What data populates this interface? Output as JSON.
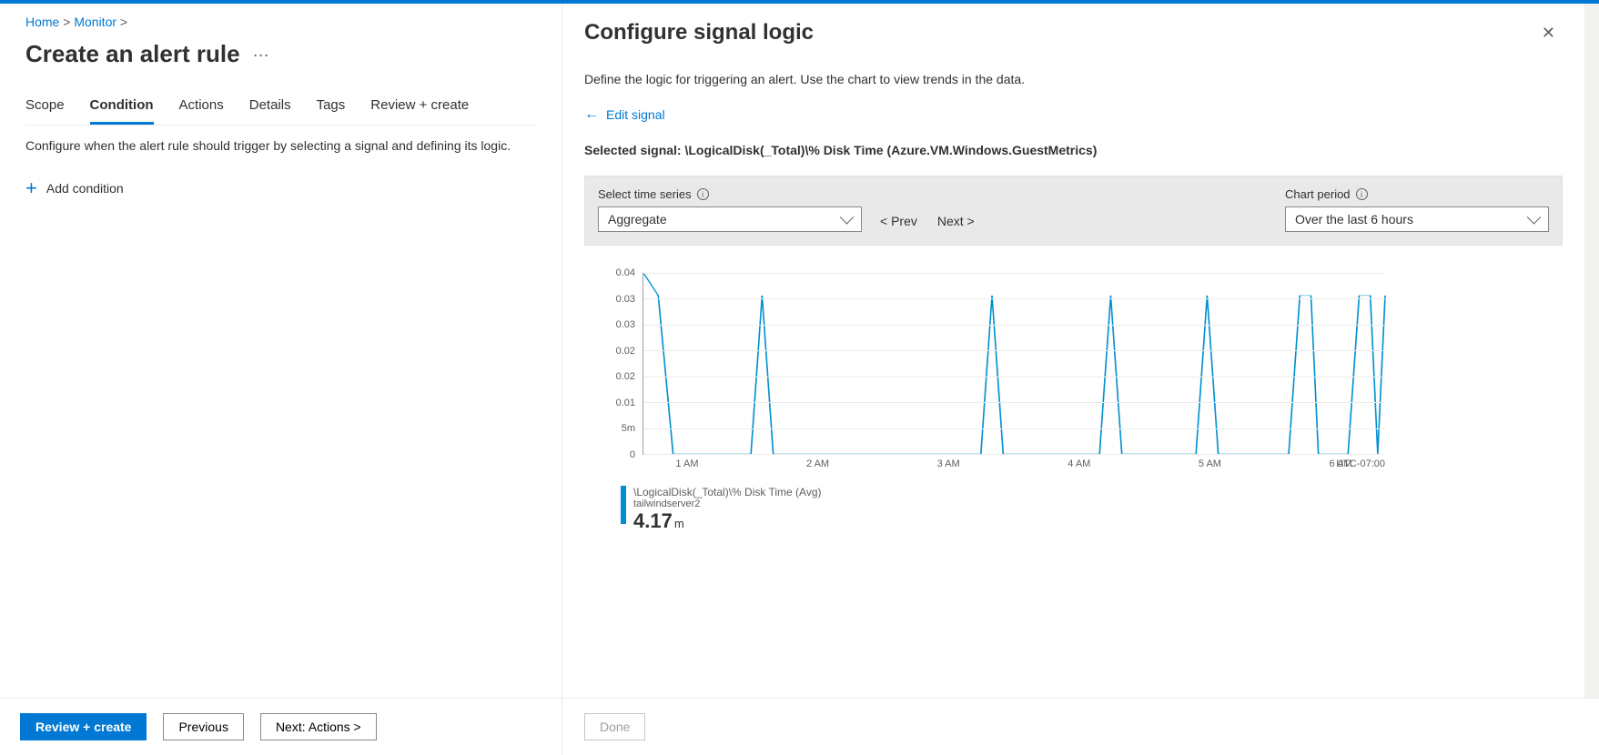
{
  "breadcrumbs": {
    "home": "Home",
    "monitor": "Monitor"
  },
  "page_title": "Create an alert rule",
  "tabs": [
    "Scope",
    "Condition",
    "Actions",
    "Details",
    "Tags",
    "Review + create"
  ],
  "active_tab": "Condition",
  "condition_desc": "Configure when the alert rule should trigger by selecting a signal and defining its logic.",
  "add_condition": "Add condition",
  "footer": {
    "review_create": "Review + create",
    "previous": "Previous",
    "next": "Next: Actions >"
  },
  "blade_title": "Configure signal logic",
  "blade_desc": "Define the logic for triggering an alert. Use the chart to view trends in the data.",
  "edit_signal": "Edit signal",
  "selected_signal_label": "Selected signal:",
  "selected_signal_value": "\\LogicalDisk(_Total)\\% Disk Time (Azure.VM.Windows.GuestMetrics)",
  "controls": {
    "time_series_label": "Select time series",
    "time_series_value": "Aggregate",
    "prev": "< Prev",
    "next": "Next >",
    "chart_period_label": "Chart period",
    "chart_period_value": "Over the last 6 hours"
  },
  "legend": {
    "metric": "\\LogicalDisk(_Total)\\% Disk Time (Avg)",
    "resource": "tailwindserver2",
    "value": "4.17",
    "unit": "m"
  },
  "done": "Done",
  "chart_data": {
    "type": "line",
    "title": "",
    "xlabel": "",
    "ylabel": "",
    "ylim": [
      0,
      0.04
    ],
    "y_ticks": [
      "0",
      "5m",
      "0.01",
      "0.02",
      "0.02",
      "0.03",
      "0.03",
      "0.04"
    ],
    "x_ticks": [
      "1 AM",
      "2 AM",
      "3 AM",
      "4 AM",
      "5 AM",
      "6 AM"
    ],
    "timezone": "UTC-07:00",
    "series": [
      {
        "name": "\\LogicalDisk(_Total)\\% Disk Time (Avg) — tailwindserver2",
        "x": [
          0.0,
          0.02,
          0.04,
          0.06,
          0.145,
          0.16,
          0.175,
          0.19,
          0.455,
          0.47,
          0.485,
          0.5,
          0.615,
          0.63,
          0.645,
          0.7,
          0.745,
          0.76,
          0.775,
          0.8,
          0.87,
          0.885,
          0.9,
          0.91,
          0.95,
          0.965,
          0.98,
          0.99,
          1.0
        ],
        "y": [
          0.04,
          0.035,
          0,
          0,
          0,
          0.035,
          0,
          0,
          0,
          0.035,
          0,
          0,
          0,
          0.035,
          0,
          0,
          0,
          0.035,
          0,
          0,
          0,
          0.035,
          0.035,
          0,
          0,
          0.035,
          0.035,
          0,
          0.035
        ]
      }
    ]
  }
}
